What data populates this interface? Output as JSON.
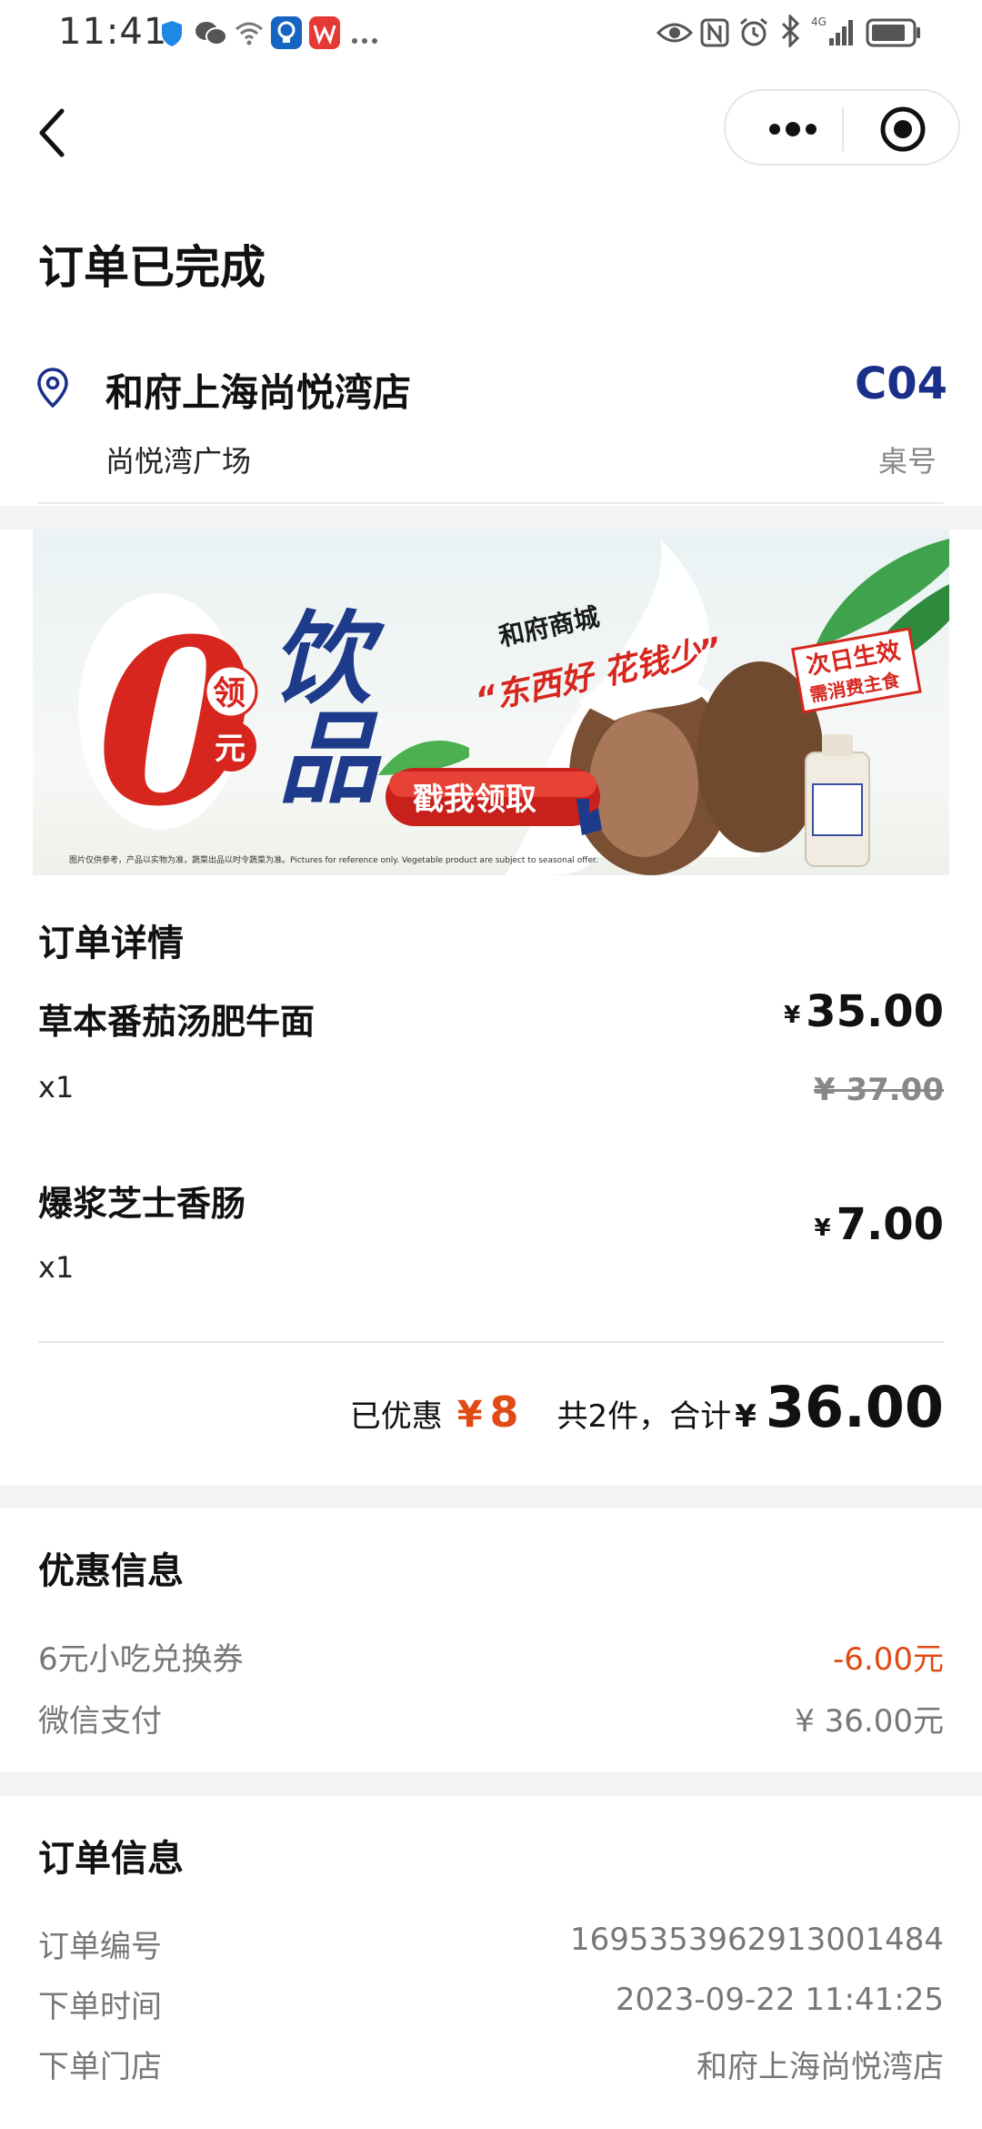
{
  "status_bar": {
    "time": "11:41",
    "icons": [
      "shield-icon",
      "wechat-icon",
      "wifi-icon",
      "bulb-app-icon",
      "wps-app-icon",
      "more-dots-icon",
      "eye-icon",
      "nfc-icon",
      "alarm-icon",
      "bluetooth-icon",
      "signal-icon",
      "battery-icon"
    ],
    "network": "4G"
  },
  "header": {
    "status_title": "订单已完成"
  },
  "store": {
    "name": "和府上海尚悦湾店",
    "area": "尚悦湾广场",
    "table_number": "C04",
    "table_label": "桌号"
  },
  "banner": {
    "zero": "0",
    "ling": "领",
    "yuan": "元",
    "drink_top": "饮",
    "drink_bottom": "品",
    "brand": "和府商城",
    "slogan": "“东西好 花钱少”",
    "button": "戳我领取",
    "badge_line1": "次日生效",
    "badge_line2": "需消费主食",
    "disclaimer": "图片仅供参考，产品以实物为准，蔬菜出品以时令蔬菜为准。Pictures for reference only. Vegetable product are subject to seasonal offer."
  },
  "order_details": {
    "title": "订单详情",
    "currency": "¥",
    "items": [
      {
        "name": "草本番茄汤肥牛面",
        "qty": "x1",
        "price": "35.00",
        "original_price": "¥ 37.00"
      },
      {
        "name": "爆浆芝士香肠",
        "qty": "x1",
        "price": "7.00"
      }
    ],
    "summary": {
      "discount_label": "已优惠",
      "discount_currency": "¥",
      "discount_amount": "8",
      "count_label": "共2件，合计",
      "total_currency": "¥",
      "total_amount": "36.00"
    }
  },
  "discount_info": {
    "title": "优惠信息",
    "rows": [
      {
        "label": "6元小吃兑换券",
        "value": "-6.00元"
      },
      {
        "label": "微信支付",
        "value": "¥ 36.00元"
      }
    ]
  },
  "order_info": {
    "title": "订单信息",
    "rows": [
      {
        "label": "订单编号",
        "value": "1695353962913001484"
      },
      {
        "label": "下单时间",
        "value": "2023-09-22 11:41:25"
      },
      {
        "label": "下单门店",
        "value": "和府上海尚悦湾店"
      }
    ]
  },
  "colors": {
    "accent_red": "#e04a14",
    "table_blue": "#1a2f8a",
    "band_gray": "#f3f3f3"
  }
}
